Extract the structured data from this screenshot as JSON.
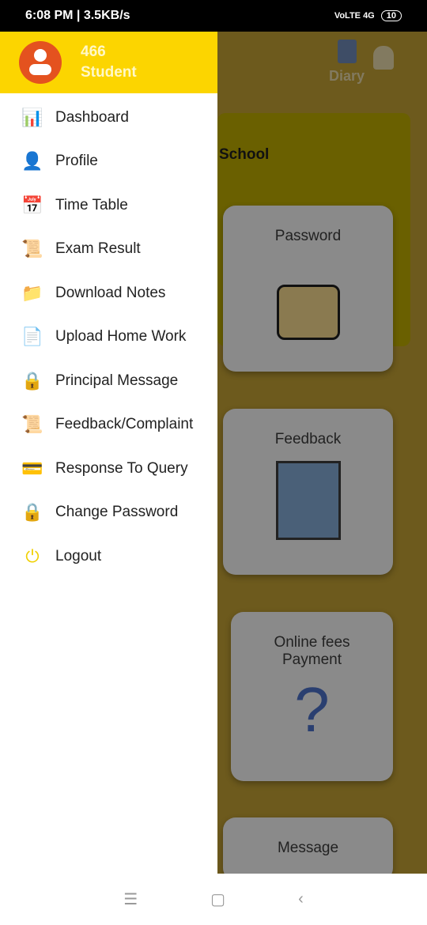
{
  "status": {
    "time": "6:08 PM | 3.5KB/s",
    "battery": "10",
    "network": "VoLTE 4G"
  },
  "background": {
    "diary": "Diary",
    "school": "School",
    "cards": [
      "Password",
      "Feedback",
      "Online fees Payment",
      "Message"
    ]
  },
  "drawer": {
    "user_id": "466",
    "role": "Student",
    "items": [
      {
        "label": "Dashboard",
        "icon": "dashboard-icon",
        "glyph": "📊"
      },
      {
        "label": "Profile",
        "icon": "person-icon",
        "glyph": "👤"
      },
      {
        "label": "Time Table",
        "icon": "calendar-icon",
        "glyph": "📅"
      },
      {
        "label": "Exam Result",
        "icon": "scroll-icon",
        "glyph": "📜"
      },
      {
        "label": "Download Notes",
        "icon": "folder-download-icon",
        "glyph": "📁"
      },
      {
        "label": "Upload Home Work",
        "icon": "document-upload-icon",
        "glyph": "📄"
      },
      {
        "label": "Principal Message",
        "icon": "lock-shield-icon",
        "glyph": "🔒"
      },
      {
        "label": "Feedback/Complaint",
        "icon": "scroll-icon",
        "glyph": "📜"
      },
      {
        "label": "Response To Query",
        "icon": "card-check-icon",
        "glyph": "💳"
      },
      {
        "label": "Change Password",
        "icon": "lock-shield-icon",
        "glyph": "🔒"
      },
      {
        "label": "Logout",
        "icon": "power-icon",
        "glyph": "⏻"
      }
    ]
  },
  "colors": {
    "header": "#fcd500",
    "avatar": "#e4521f",
    "logout": "#f0d000"
  }
}
